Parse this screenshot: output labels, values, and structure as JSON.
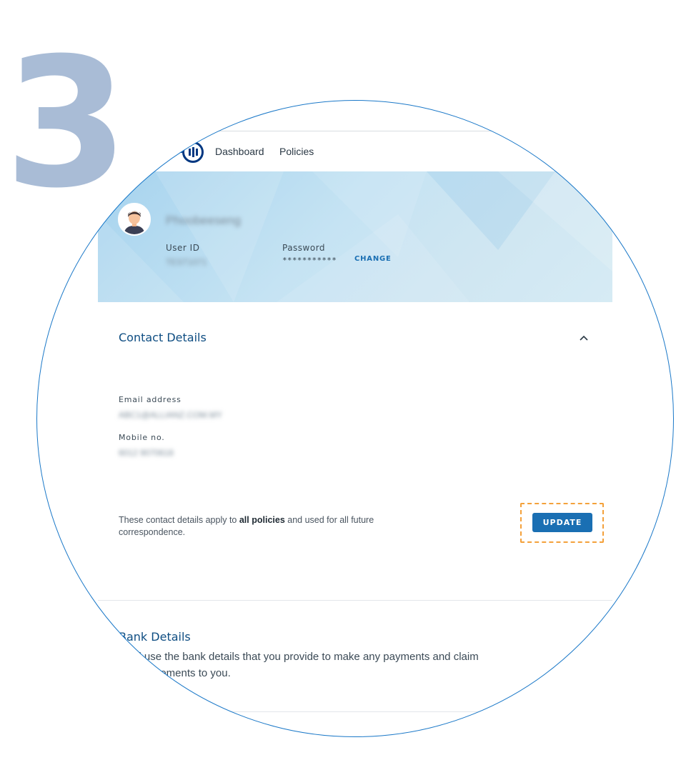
{
  "step": {
    "number": "3"
  },
  "nav": {
    "links": [
      "Dashboard",
      "Policies"
    ]
  },
  "profile": {
    "name": "Phoobeeseng",
    "user_id_label": "User ID",
    "user_id_value": "TEST1071",
    "password_label": "Password",
    "password_value": "***********",
    "change_label": "CHANGE"
  },
  "contact": {
    "title": "Contact Details",
    "email_label": "Email address",
    "email_value": "ABC1@ALLIANZ.COM.MY",
    "mobile_label": "Mobile no.",
    "mobile_value": "6012 9070618",
    "note_before": "These contact details apply to ",
    "note_bold": "all policies",
    "note_after": " and used for all future correspondence.",
    "update_label": "UPDATE"
  },
  "bank": {
    "title": "Bank Details",
    "description": "We'll use the bank details that you provide to make any payments and claim reimbursements to you."
  },
  "colors": {
    "step_number": "#a9bcd6",
    "brand_blue": "#003781",
    "accent_blue": "#1a6fb3",
    "highlight_orange": "#f4a13b",
    "lens_border": "#1a78c8"
  },
  "icons": {
    "logo": "allianz-logo-icon",
    "avatar": "user-avatar-icon",
    "collapse": "chevron-up-icon"
  }
}
